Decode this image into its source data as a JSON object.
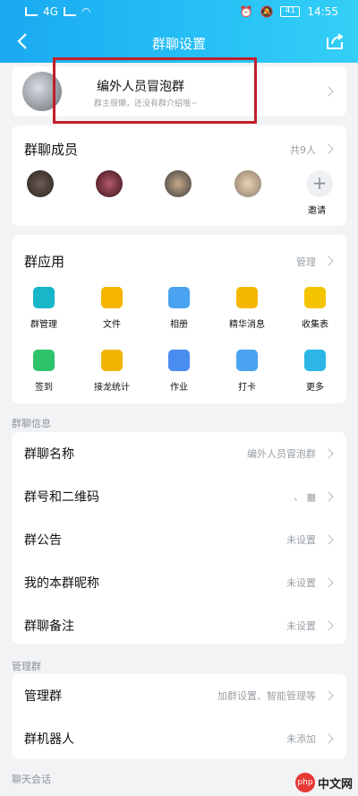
{
  "status": {
    "left_text": "4G",
    "time": "14:55",
    "battery": "41"
  },
  "nav": {
    "title": "群聊设置"
  },
  "group": {
    "name": "编外人员冒泡群",
    "desc": "群主很懒，还没有群介绍哦~"
  },
  "members": {
    "title": "群聊成员",
    "count": "共9人",
    "invite": "邀请"
  },
  "apps": {
    "title": "群应用",
    "manage": "管理",
    "items": [
      {
        "label": "群管理",
        "icon": "group-manage-icon",
        "color": "#17b6c8"
      },
      {
        "label": "文件",
        "icon": "folder-icon",
        "color": "#f7b500"
      },
      {
        "label": "相册",
        "icon": "album-icon",
        "color": "#4aa3f0"
      },
      {
        "label": "精华消息",
        "icon": "essence-icon",
        "color": "#f5b800"
      },
      {
        "label": "收集表",
        "icon": "form-icon",
        "color": "#f5c400"
      },
      {
        "label": "签到",
        "icon": "checkin-icon",
        "color": "#2dc36a"
      },
      {
        "label": "接龙统计",
        "icon": "relay-icon",
        "color": "#f0b400"
      },
      {
        "label": "作业",
        "icon": "homework-icon",
        "color": "#4a8df0"
      },
      {
        "label": "打卡",
        "icon": "punch-icon",
        "color": "#4aa3f0"
      },
      {
        "label": "更多",
        "icon": "more-icon",
        "color": "#2bb6e6"
      }
    ]
  },
  "info": {
    "label": "群聊信息",
    "rows": [
      {
        "label": "群聊名称",
        "value": "编外人员冒泡群"
      },
      {
        "label": "群号和二维码",
        "value": "、 ▦"
      },
      {
        "label": "群公告",
        "value": "未设置"
      },
      {
        "label": "我的本群昵称",
        "value": "未设置"
      },
      {
        "label": "群聊备注",
        "value": "未设置"
      }
    ]
  },
  "manage": {
    "label": "管理群",
    "rows": [
      {
        "label": "管理群",
        "value": "加群设置、智能管理等"
      },
      {
        "label": "群机器人",
        "value": "未添加"
      }
    ]
  },
  "chat": {
    "label": "聊天会话"
  },
  "watermark": {
    "logo": "php",
    "text": "中文网"
  }
}
